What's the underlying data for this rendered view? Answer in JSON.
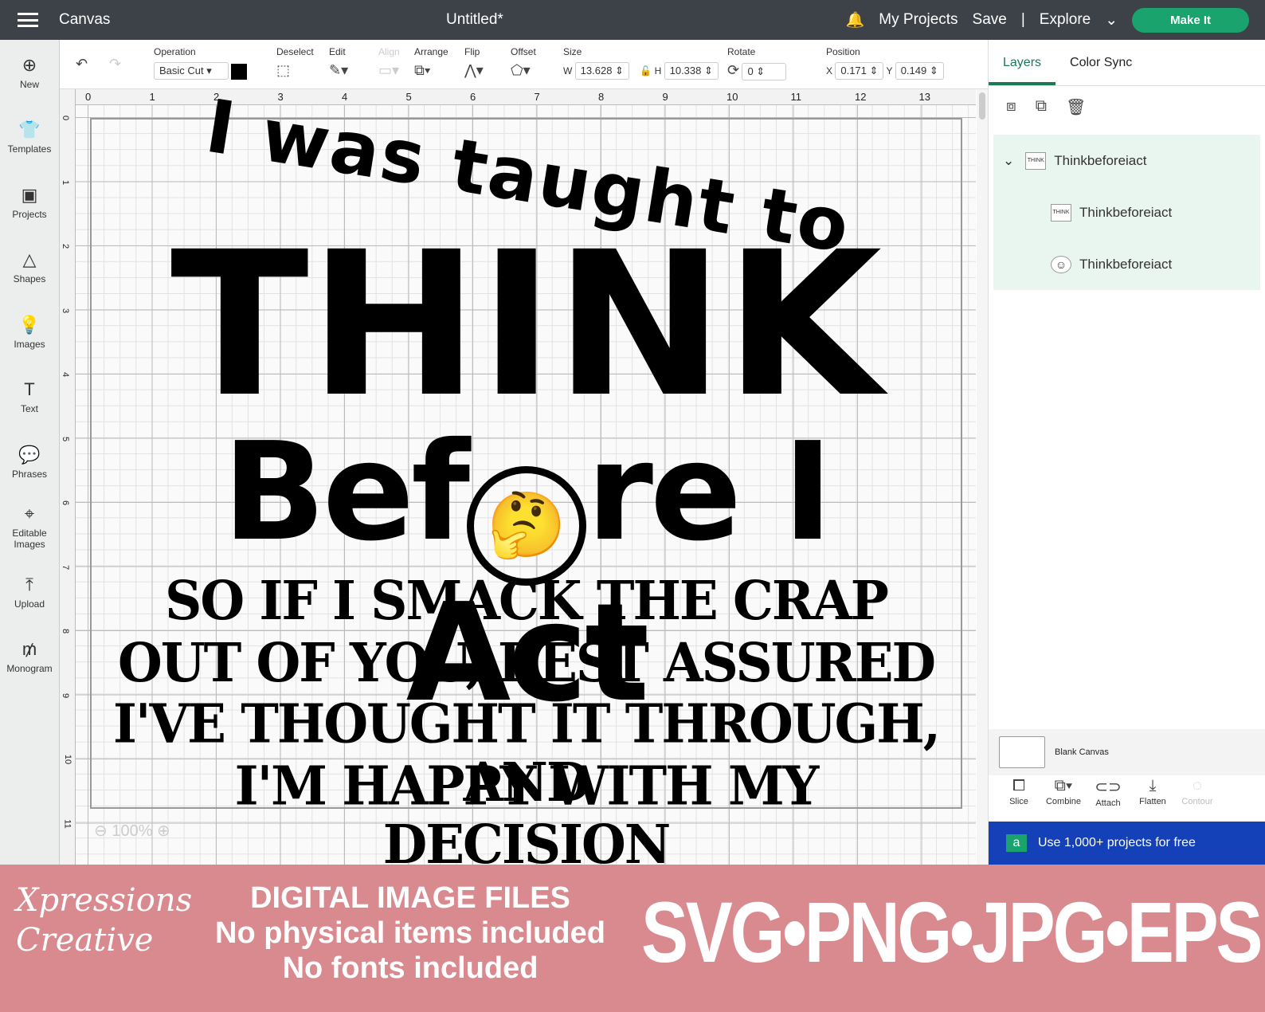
{
  "topbar": {
    "title": "Canvas",
    "doc_title": "Untitled*",
    "my_projects": "My Projects",
    "save": "Save",
    "separator": "|",
    "explore": "Explore",
    "make_it": "Make It"
  },
  "sidebar": [
    {
      "label": "New",
      "icon": "⊕"
    },
    {
      "label": "Templates",
      "icon": "👕"
    },
    {
      "label": "Projects",
      "icon": "▣"
    },
    {
      "label": "Shapes",
      "icon": "△"
    },
    {
      "label": "Images",
      "icon": "💡"
    },
    {
      "label": "Text",
      "icon": "T"
    },
    {
      "label": "Phrases",
      "icon": "💬"
    },
    {
      "label": "Editable Images",
      "icon": "⌖"
    },
    {
      "label": "Upload",
      "icon": "⤒"
    },
    {
      "label": "Monogram",
      "icon": "₥"
    }
  ],
  "toolbar": {
    "operation_label": "Operation",
    "operation_value": "Basic Cut",
    "deselect": "Deselect",
    "edit": "Edit",
    "align": "Align",
    "arrange": "Arrange",
    "flip": "Flip",
    "offset": "Offset",
    "size": "Size",
    "w_label": "W",
    "w_value": "13.628",
    "h_label": "H",
    "h_value": "10.338",
    "rotate": "Rotate",
    "rotate_value": "0",
    "position": "Position",
    "x_label": "X",
    "x_value": "0.171",
    "y_label": "Y",
    "y_value": "0.149"
  },
  "ruler_top": [
    "0",
    "1",
    "2",
    "3",
    "4",
    "5",
    "6",
    "7",
    "8",
    "9",
    "10",
    "11",
    "12",
    "13"
  ],
  "ruler_left": [
    "0",
    "1",
    "2",
    "3",
    "4",
    "5",
    "6",
    "7",
    "8",
    "9",
    "10",
    "11"
  ],
  "design": {
    "line1": "I was taught to",
    "line2": "THINK",
    "line3a": "Bef",
    "line3b": "re I Act",
    "emoji": "🤔",
    "slab": [
      "SO IF I SMACK THE CRAP",
      "OUT OF YOU, REST ASSURED",
      "I'VE THOUGHT IT THROUGH, AND",
      "I'M HAPPY WITH MY DECISION"
    ]
  },
  "zoom": "100%",
  "panel": {
    "tabs": [
      "Layers",
      "Color Sync"
    ],
    "layers": [
      "Thinkbeforeiact",
      "Thinkbeforeiact",
      "Thinkbeforeiact"
    ],
    "blank_canvas": "Blank Canvas",
    "actions": [
      "Slice",
      "Combine",
      "Attach",
      "Flatten",
      "Contour"
    ],
    "promo": "Use 1,000+ projects for free",
    "promo_badge": "a"
  },
  "banner": {
    "logo_line1": "Xpressions",
    "logo_line2": "Creative",
    "line1": "DIGITAL IMAGE FILES",
    "line2": "No physical items included",
    "line3": "No fonts included",
    "formats": "SVG•PNG•JPG•EPS"
  },
  "colors": {
    "accent": "#1aa36d",
    "topbar": "#3d4148",
    "banner": "#d98a8f",
    "promo": "#1541b8"
  }
}
